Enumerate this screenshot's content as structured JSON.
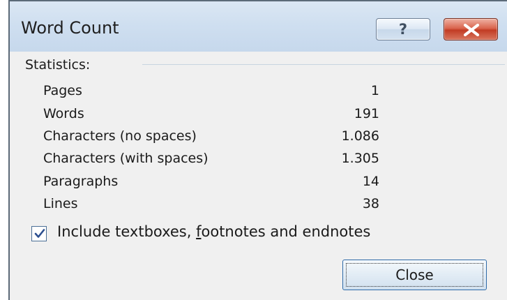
{
  "window": {
    "title": "Word Count",
    "help_glyph": "?",
    "help_icon": "question-mark-icon",
    "close_icon": "close-x-icon"
  },
  "statistics": {
    "label": "Statistics:",
    "rows": [
      {
        "name": "Pages",
        "value": "1"
      },
      {
        "name": "Words",
        "value": "191"
      },
      {
        "name": "Characters (no spaces)",
        "value": "1.086"
      },
      {
        "name": "Characters (with spaces)",
        "value": "1.305"
      },
      {
        "name": "Paragraphs",
        "value": "14"
      },
      {
        "name": "Lines",
        "value": "38"
      }
    ]
  },
  "options": {
    "include_checkbox": {
      "checked": true,
      "label_before": "Include textboxes, ",
      "label_hotkey": "f",
      "label_after": "ootnotes and endnotes"
    }
  },
  "buttons": {
    "close_label": "Close"
  },
  "colors": {
    "titlebar": "#cfdff0",
    "body": "#f0f0f0",
    "close_x_red": "#c23c24",
    "focus_border": "#2e6aa8"
  }
}
